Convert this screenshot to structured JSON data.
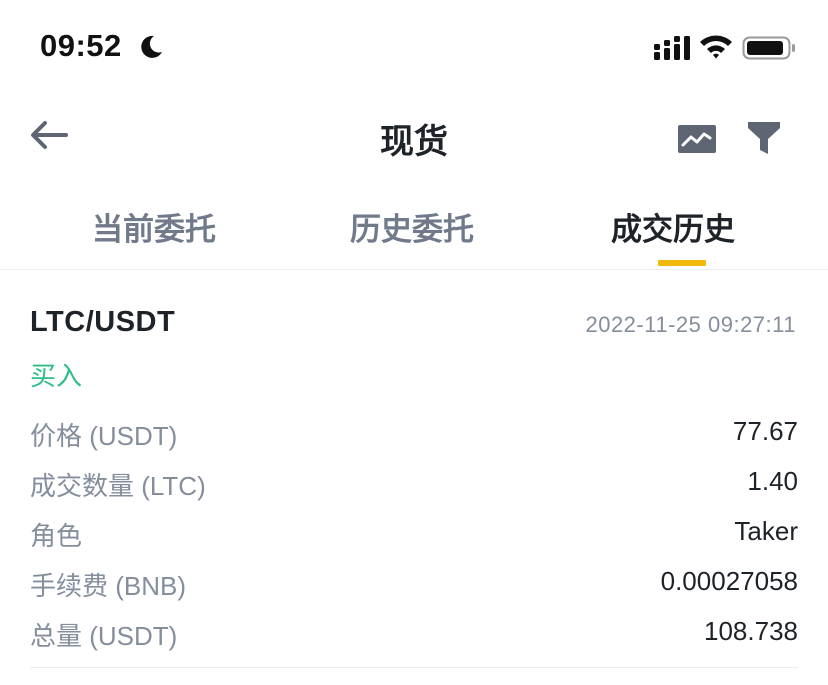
{
  "status_bar": {
    "time": "09:52"
  },
  "nav": {
    "title": "现货",
    "icons": [
      "back-arrow-icon",
      "chart-icon",
      "filter-icon"
    ]
  },
  "tabs": [
    {
      "label": "当前委托",
      "active": false
    },
    {
      "label": "历史委托",
      "active": false
    },
    {
      "label": "成交历史",
      "active": true
    }
  ],
  "trade": {
    "pair": "LTC/USDT",
    "timestamp": "2022-11-25 09:27:11",
    "side": "买入",
    "rows": [
      {
        "label": "价格 (USDT)",
        "value": "77.67"
      },
      {
        "label": "成交数量 (LTC)",
        "value": "1.40"
      },
      {
        "label": "角色",
        "value": "Taker"
      },
      {
        "label": "手续费 (BNB)",
        "value": "0.00027058"
      },
      {
        "label": "总量 (USDT)",
        "value": "108.738"
      }
    ]
  },
  "colors": {
    "accent": "#f0b90b",
    "buy": "#2ebd85",
    "text_primary": "#1e2329",
    "text_secondary": "#848e9c"
  }
}
